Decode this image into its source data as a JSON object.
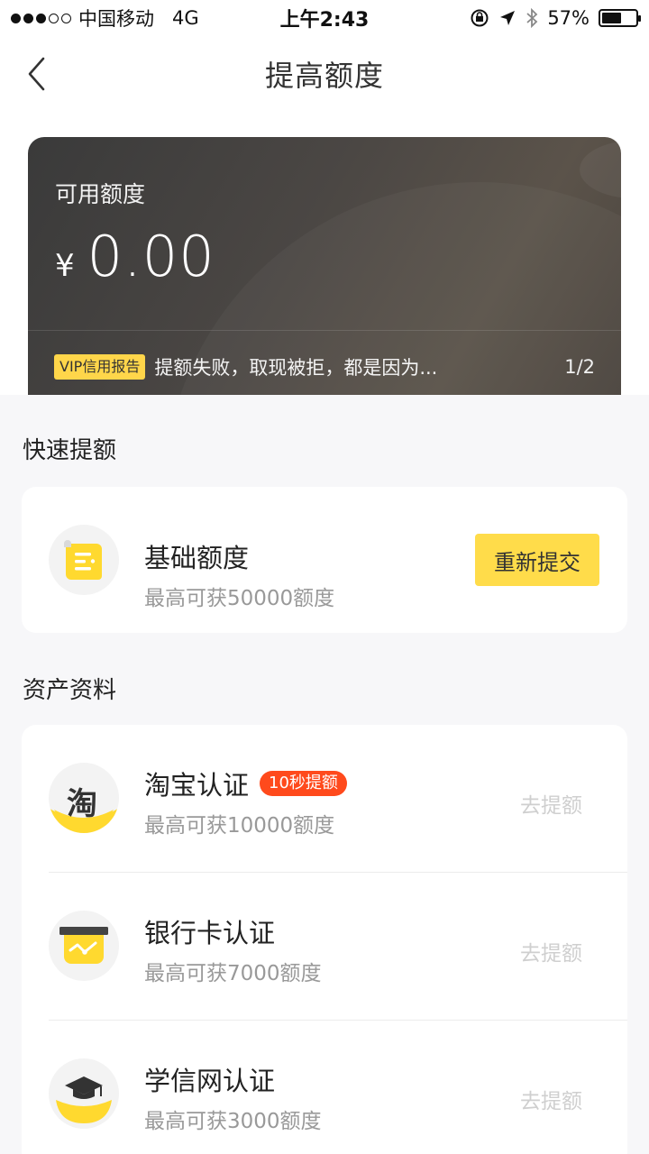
{
  "status_bar": {
    "carrier": "中国移动",
    "network": "4G",
    "time": "上午2:43",
    "battery": "57%",
    "battery_level": 0.57
  },
  "nav": {
    "title": "提高额度"
  },
  "card": {
    "label": "可用额度",
    "currency": "¥",
    "amount": "0.00",
    "vip_badge": "VIP信用报告",
    "notice": "提额失败，取现被拒，都是因为...",
    "page": "1/2"
  },
  "quick": {
    "title": "快速提额",
    "item": {
      "name": "基础额度",
      "subtitle": "最高可获50000额度",
      "button": "重新提交",
      "icon": "document-icon"
    }
  },
  "assets": {
    "title": "资产资料",
    "items": [
      {
        "name": "淘宝认证",
        "badge": "10秒提额",
        "subtitle": "最高可获10000额度",
        "action": "去提额",
        "icon": "taobao-icon",
        "glyph": "淘"
      },
      {
        "name": "银行卡认证",
        "badge": "",
        "subtitle": "最高可获7000额度",
        "action": "去提额",
        "icon": "bank-card-icon"
      },
      {
        "name": "学信网认证",
        "badge": "",
        "subtitle": "最高可获3000额度",
        "action": "去提额",
        "icon": "graduation-cap-icon"
      }
    ]
  },
  "colors": {
    "accent": "#ffdc4a",
    "badge_red": "#ff4a1c",
    "card_dark": "#4b4744"
  }
}
